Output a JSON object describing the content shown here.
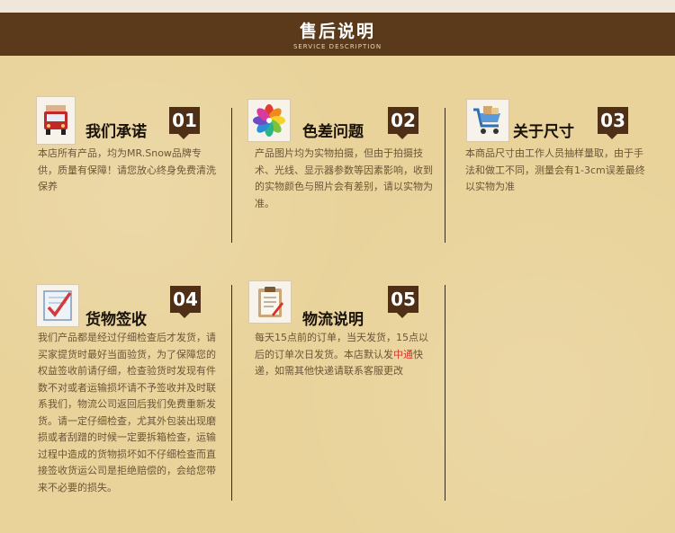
{
  "header": {
    "title": "售后说明",
    "subtitle": "SERVICE DESCRIPTION"
  },
  "cards": [
    {
      "number": "01",
      "heading": "我们承诺",
      "icon": "truck-icon",
      "text": "本店所有产品，均为MR.Snow品牌专供，质量有保障！请您放心终身免费清洗保养"
    },
    {
      "number": "02",
      "heading": "色差问题",
      "icon": "color-wheel-icon",
      "text": "产品图片均为实物拍摄，但由于拍摄技术、光线、显示器参数等因素影响，收到的实物颜色与照片会有差别，请以实物为准。"
    },
    {
      "number": "03",
      "heading": "关于尺寸",
      "icon": "shopping-cart-icon",
      "text": "本商品尺寸由工作人员抽样量取，由于手法和做工不同，测量会有1-3cm误差最终以实物为准"
    },
    {
      "number": "04",
      "heading": "货物签收",
      "icon": "checklist-icon",
      "text": "我们产品都是经过仔细检查后才发货，请买家提货时最好当面验货，为了保障您的权益签收前请仔细，检查验货时发现有件数不对或者运输损坏请不予签收并及时联系我们，物流公司返回后我们免费重新发货。请一定仔细检查，尤其外包装出现磨损或者刮蹭的时候一定要拆箱检查，运输过程中造成的货物损坏如不仔细检查而直接签收货运公司是拒绝赔偿的，会给您带来不必要的损失。"
    },
    {
      "number": "05",
      "heading": "物流说明",
      "icon": "clipboard-icon",
      "text_before": "每天15点前的订单，当天发货，15点以后的订单次日发货。本店默认发",
      "text_highlight": "中通",
      "text_after": "快递，如需其他快递请联系客服更改"
    }
  ],
  "colors": {
    "header_bg": "#5a3a1a",
    "badge_bg": "#4f2f16",
    "panel_bg": "#e9d39b",
    "body_text": "#6a5537",
    "highlight": "#d8332a"
  }
}
